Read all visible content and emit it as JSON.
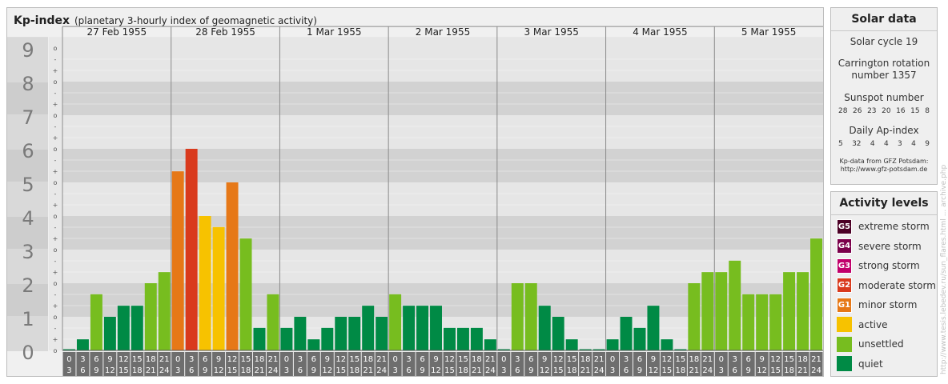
{
  "header": {
    "title": "Kp-index",
    "subtitle": "(planetary 3-hourly index of geomagnetic activity)"
  },
  "chart_data": {
    "type": "bar",
    "title": "Kp-index",
    "subtitle": "(planetary 3-hourly index of geomagnetic activity)",
    "days": [
      "27 Feb 1955",
      "28 Feb 1955",
      "1 Mar 1955",
      "2 Mar 1955",
      "3 Mar 1955",
      "4 Mar 1955",
      "5 Mar 1955"
    ],
    "hours_from": [
      "0",
      "3",
      "6",
      "9",
      "12",
      "15",
      "18",
      "21"
    ],
    "hours_to": [
      "3",
      "6",
      "9",
      "12",
      "15",
      "18",
      "21",
      "24"
    ],
    "y_ticks": [
      "0",
      "1",
      "2",
      "3",
      "4",
      "5",
      "6",
      "7",
      "8",
      "9"
    ],
    "minor_ticks": [
      "o",
      "+",
      "-"
    ],
    "ylim": [
      0,
      9.33
    ],
    "kp_values": [
      [
        0.0,
        0.33,
        1.67,
        1.0,
        1.33,
        1.33,
        2.0,
        2.33
      ],
      [
        5.33,
        6.0,
        4.0,
        3.67,
        5.0,
        3.33,
        0.67,
        1.67
      ],
      [
        0.67,
        1.0,
        0.33,
        0.67,
        1.0,
        1.0,
        1.33,
        1.0
      ],
      [
        1.67,
        1.33,
        1.33,
        1.33,
        0.67,
        0.67,
        0.67,
        0.33
      ],
      [
        0.0,
        2.0,
        2.0,
        1.33,
        1.0,
        0.33,
        0.0,
        0.0
      ],
      [
        0.33,
        1.0,
        0.67,
        1.33,
        0.33,
        0.0,
        2.0,
        2.33
      ],
      [
        2.33,
        2.67,
        1.67,
        1.67,
        1.67,
        2.33,
        2.33,
        3.33
      ]
    ],
    "level_colors": {
      "quiet": "#008a45",
      "unsettled": "#77bd1f",
      "active": "#f7c200",
      "minor_storm": "#e67817",
      "moderate_storm": "#d93a1d",
      "strong_storm": "#c1006b",
      "severe_storm": "#7b004b",
      "extreme_storm": "#4c0026"
    },
    "grid": true
  },
  "solar": {
    "title": "Solar data",
    "cycle": "Solar cycle 19",
    "carrington_line1": "Carrington rotation",
    "carrington_line2": "number 1357",
    "sunspot_label": "Sunspot number",
    "sunspot_values": [
      "28",
      "26",
      "23",
      "20",
      "16",
      "15",
      "8"
    ],
    "ap_label": "Daily Ap-index",
    "ap_values": [
      "5",
      "32",
      "4",
      "4",
      "3",
      "4",
      "9"
    ],
    "source_line1": "Kp-data from GFZ Potsdam:",
    "source_line2": "http://www.gfz-potsdam.de"
  },
  "legend": {
    "title": "Activity levels",
    "items": [
      {
        "code": "G5",
        "label": "extreme storm",
        "color": "#4c0026"
      },
      {
        "code": "G4",
        "label": "severe storm",
        "color": "#7b004b"
      },
      {
        "code": "G3",
        "label": "strong storm",
        "color": "#c1006b"
      },
      {
        "code": "G2",
        "label": "moderate storm",
        "color": "#d93a1d"
      },
      {
        "code": "G1",
        "label": "minor storm",
        "color": "#e67817"
      },
      {
        "code": "",
        "label": "active",
        "color": "#f7c200"
      },
      {
        "code": "",
        "label": "unsettled",
        "color": "#77bd1f"
      },
      {
        "code": "",
        "label": "quiet",
        "color": "#008a45"
      }
    ]
  },
  "watermark": "http://www.tesis.lebedev.ru/sun_flares.html ... archive.php"
}
